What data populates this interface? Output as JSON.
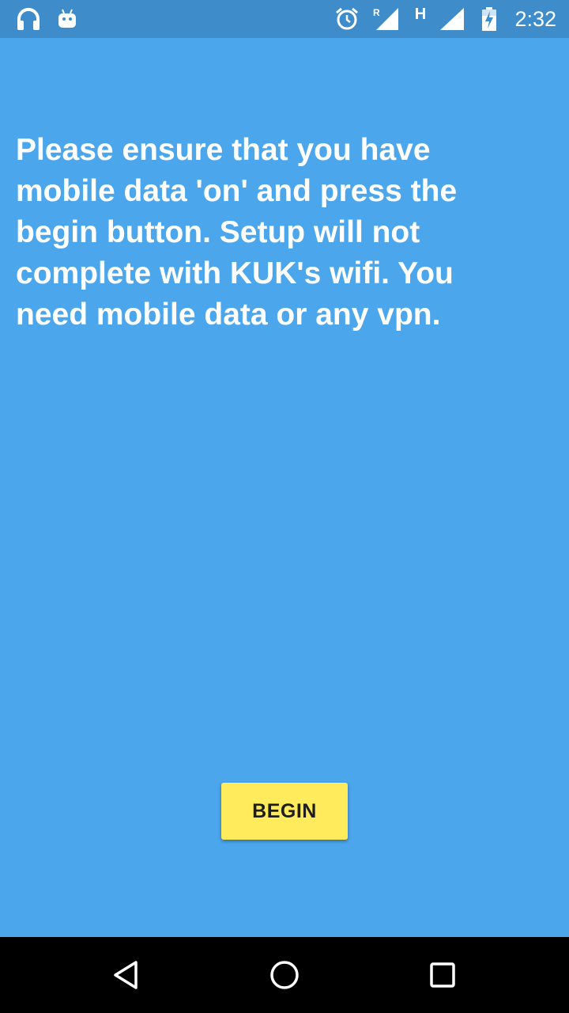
{
  "status_bar": {
    "time": "2:32",
    "icons": [
      "headphones-icon",
      "android-icon",
      "alarm-icon",
      "signal-roaming-icon",
      "network-type-icon",
      "signal-icon",
      "battery-charging-icon"
    ],
    "network_type": "H",
    "roaming_label": "R",
    "background_color": "#3f8ccb"
  },
  "main": {
    "message": "Please ensure that you have mobile data 'on' and press the begin button. Setup will not complete with KUK's wifi. You need mobile data or any vpn.",
    "begin_label": "BEGIN",
    "background_color": "#4ca6ec",
    "button_color": "#ffeb5c"
  },
  "nav_bar": {
    "icons": [
      "back-icon",
      "home-icon",
      "recents-icon"
    ]
  }
}
